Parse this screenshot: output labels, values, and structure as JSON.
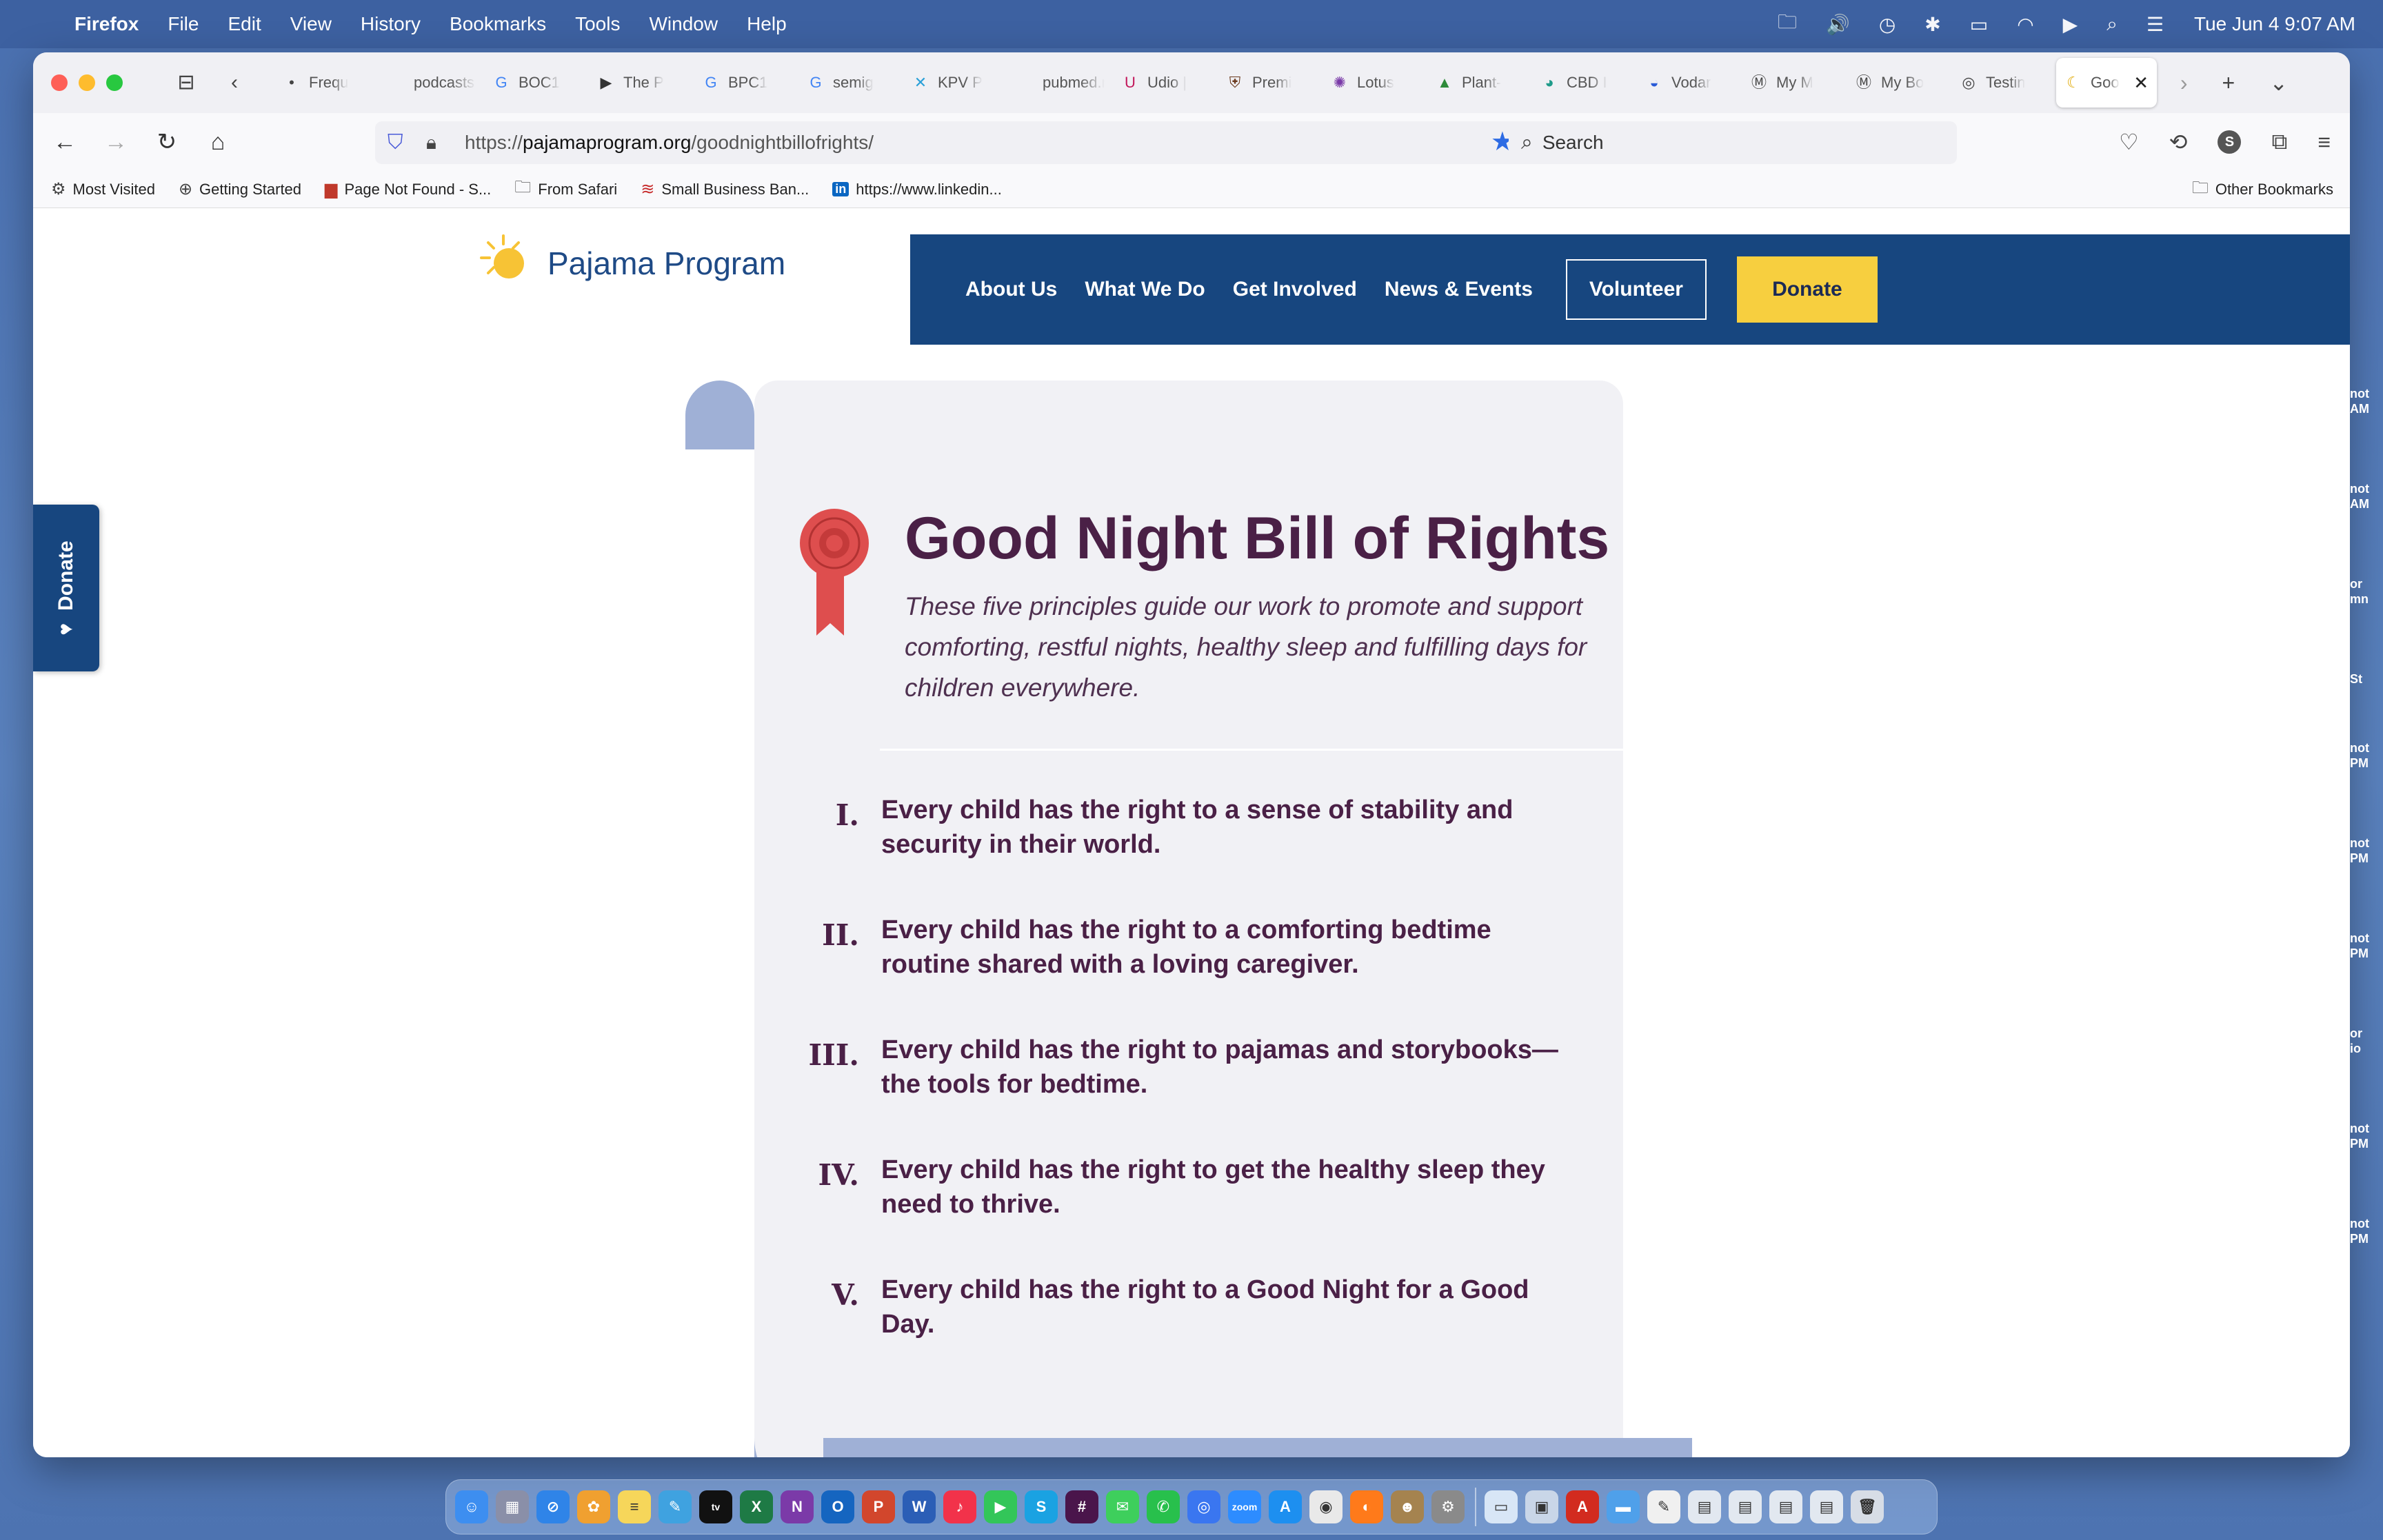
{
  "menubar": {
    "apple": "",
    "app_name": "Firefox",
    "items": [
      "File",
      "Edit",
      "View",
      "History",
      "Bookmarks",
      "Tools",
      "Window",
      "Help"
    ],
    "clock": "Tue Jun 4  9:07 AM",
    "status_icons": [
      "folder-icon",
      "volume-icon",
      "time-machine-icon",
      "bluetooth-icon",
      "battery-icon",
      "wifi-icon",
      "play-icon",
      "spotlight-icon",
      "control-center-icon"
    ]
  },
  "browser": {
    "tabs": [
      {
        "label": "Frequ",
        "icon": "chevron-icon"
      },
      {
        "label": "podcasts.",
        "icon": "none"
      },
      {
        "label": "BOC1",
        "icon": "google-icon"
      },
      {
        "label": "The P",
        "icon": "media-icon"
      },
      {
        "label": "BPC1",
        "icon": "google-icon"
      },
      {
        "label": "semig",
        "icon": "google-icon"
      },
      {
        "label": "KPV P",
        "icon": "molecule-icon"
      },
      {
        "label": "pubmed.n",
        "icon": "none"
      },
      {
        "label": "Udio |",
        "icon": "udio-icon"
      },
      {
        "label": "Premi",
        "icon": "crest-icon"
      },
      {
        "label": "Lotus",
        "icon": "lotus-icon"
      },
      {
        "label": "Plant-",
        "icon": "plant-icon"
      },
      {
        "label": "CBD I",
        "icon": "leaf-icon"
      },
      {
        "label": "Vodar",
        "icon": "vodar-icon"
      },
      {
        "label": "My M",
        "icon": "m-icon"
      },
      {
        "label": "My Bo",
        "icon": "m-icon"
      },
      {
        "label": "Testin",
        "icon": "spiral-icon"
      },
      {
        "label": "Goo",
        "icon": "moon-icon",
        "active": true
      }
    ],
    "url_prefix": "https://",
    "url_host": "pajamaprogram.org",
    "url_path": "/goodnightbillofrights/",
    "search_placeholder": "Search",
    "profile_initial": "S",
    "bookmarks": [
      {
        "label": "Most Visited",
        "icon": "gear-icon"
      },
      {
        "label": "Getting Started",
        "icon": "globe-icon"
      },
      {
        "label": "Page Not Found - S...",
        "icon": "flag-icon"
      },
      {
        "label": "From Safari",
        "icon": "folder-icon"
      },
      {
        "label": "Small Business Ban...",
        "icon": "bank-icon"
      },
      {
        "label": "https://www.linkedin...",
        "icon": "linkedin-icon"
      }
    ],
    "other_bookmarks": "Other Bookmarks"
  },
  "site": {
    "logo_text": "Pajama Program",
    "nav": [
      "About Us",
      "What We Do",
      "Get Involved",
      "News & Events"
    ],
    "volunteer_label": "Volunteer",
    "donate_label": "Donate",
    "side_donate_label": "Donate"
  },
  "content": {
    "title": "Good Night Bill of Rights",
    "subtitle": "These five principles guide our work to promote and support comforting, restful nights, healthy sleep and fulfilling days for children everywhere.",
    "rights": [
      {
        "num": "I.",
        "text": "Every child has the right to a sense of stability and security in their world."
      },
      {
        "num": "II.",
        "text": "Every child has the right to a comforting bedtime routine shared with a loving caregiver."
      },
      {
        "num": "III.",
        "text": "Every child has the right to pajamas and storybooks—the tools for bedtime."
      },
      {
        "num": "IV.",
        "text": "Every child has the right to get the healthy sleep they need to thrive."
      },
      {
        "num": "V.",
        "text": "Every child has the right to a Good Night for a Good Day."
      }
    ]
  },
  "right_edge_fragments": [
    "not",
    "AM",
    "not",
    "AM",
    "or",
    "mn",
    "St",
    "not",
    "PM",
    "not",
    "PM",
    "not",
    "PM",
    "or",
    "io",
    "not",
    "PM",
    "not",
    "PM"
  ],
  "dock": {
    "apps": [
      {
        "name": "finder",
        "color": "#3d8ef0",
        "glyph": "☺"
      },
      {
        "name": "launchpad",
        "color": "#8a8fa8",
        "glyph": "▦"
      },
      {
        "name": "safari",
        "color": "#2f84e8",
        "glyph": "⊘"
      },
      {
        "name": "photos",
        "color": "#f0a030",
        "glyph": "✿"
      },
      {
        "name": "notes",
        "color": "#f6d65a",
        "glyph": "≡"
      },
      {
        "name": "freeform",
        "color": "#3fa2e0",
        "glyph": "✎"
      },
      {
        "name": "apple-tv",
        "color": "#111111",
        "glyph": "tv"
      },
      {
        "name": "excel",
        "color": "#1e7a45",
        "glyph": "X"
      },
      {
        "name": "onenote",
        "color": "#7b3aa8",
        "glyph": "N"
      },
      {
        "name": "outlook",
        "color": "#1565c0",
        "glyph": "O"
      },
      {
        "name": "powerpoint",
        "color": "#d2462c",
        "glyph": "P"
      },
      {
        "name": "word",
        "color": "#2b5eb6",
        "glyph": "W"
      },
      {
        "name": "music",
        "color": "#f2324a",
        "glyph": "♪"
      },
      {
        "name": "facetime",
        "color": "#33c659",
        "glyph": "▶"
      },
      {
        "name": "skype",
        "color": "#1aa2e2",
        "glyph": "S"
      },
      {
        "name": "slack",
        "color": "#4a154b",
        "glyph": "#"
      },
      {
        "name": "messages",
        "color": "#3ecf5c",
        "glyph": "✉"
      },
      {
        "name": "whatsapp",
        "color": "#28c04c",
        "glyph": "✆"
      },
      {
        "name": "signal",
        "color": "#3a76f0",
        "glyph": "◎"
      },
      {
        "name": "zoom",
        "color": "#2d8cff",
        "glyph": "zoom"
      },
      {
        "name": "app-store",
        "color": "#1d8ff0",
        "glyph": "A"
      },
      {
        "name": "chrome",
        "color": "#e9e9e9",
        "glyph": "◉"
      },
      {
        "name": "firefox",
        "color": "#ff7a1a",
        "glyph": "◐"
      },
      {
        "name": "contacts",
        "color": "#a5834f",
        "glyph": "☻"
      },
      {
        "name": "system-settings",
        "color": "#8a8a8a",
        "glyph": "⚙"
      }
    ],
    "trailing": [
      {
        "name": "files",
        "color": "#d8e6f6",
        "glyph": "▭"
      },
      {
        "name": "preview",
        "color": "#c9d6e8",
        "glyph": "▣"
      },
      {
        "name": "acrobat",
        "color": "#d22b1f",
        "glyph": "A"
      },
      {
        "name": "folder-docs",
        "color": "#4fa0ea",
        "glyph": "▬"
      },
      {
        "name": "textedit",
        "color": "#f0f0f0",
        "glyph": "✎"
      },
      {
        "name": "screenshot-1",
        "color": "#e2e8f0",
        "glyph": "▤"
      },
      {
        "name": "screenshot-2",
        "color": "#e2e8f0",
        "glyph": "▤"
      },
      {
        "name": "screenshot-3",
        "color": "#e2e8f0",
        "glyph": "▤"
      },
      {
        "name": "screenshot-4",
        "color": "#e2e8f0",
        "glyph": "▤"
      },
      {
        "name": "trash",
        "color": "#d7dde6",
        "glyph": "🗑"
      }
    ]
  },
  "colors": {
    "nav_blue": "#17467f",
    "donate_yellow": "#f7cf3f",
    "text_plum": "#4a2046",
    "scroll_bg": "#f1f1f5",
    "scroll_roll": "#9fb0d6"
  }
}
